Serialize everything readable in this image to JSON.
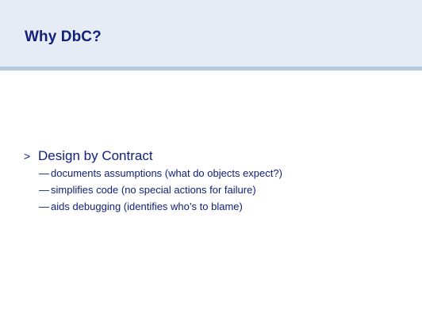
{
  "slide": {
    "title": "Why DbC?",
    "bullet": {
      "marker": ">",
      "text": "Design by Contract",
      "sub_marker": "—",
      "sub_items": [
        "documents assumptions (what do objects expect?)",
        "simplifies code (no special actions for failure)",
        "aids debugging (identifies who’s to blame)"
      ]
    }
  },
  "colors": {
    "header_bg": "#e6ecf5",
    "header_rule": "#b7c9dd",
    "text": "#13207a"
  }
}
